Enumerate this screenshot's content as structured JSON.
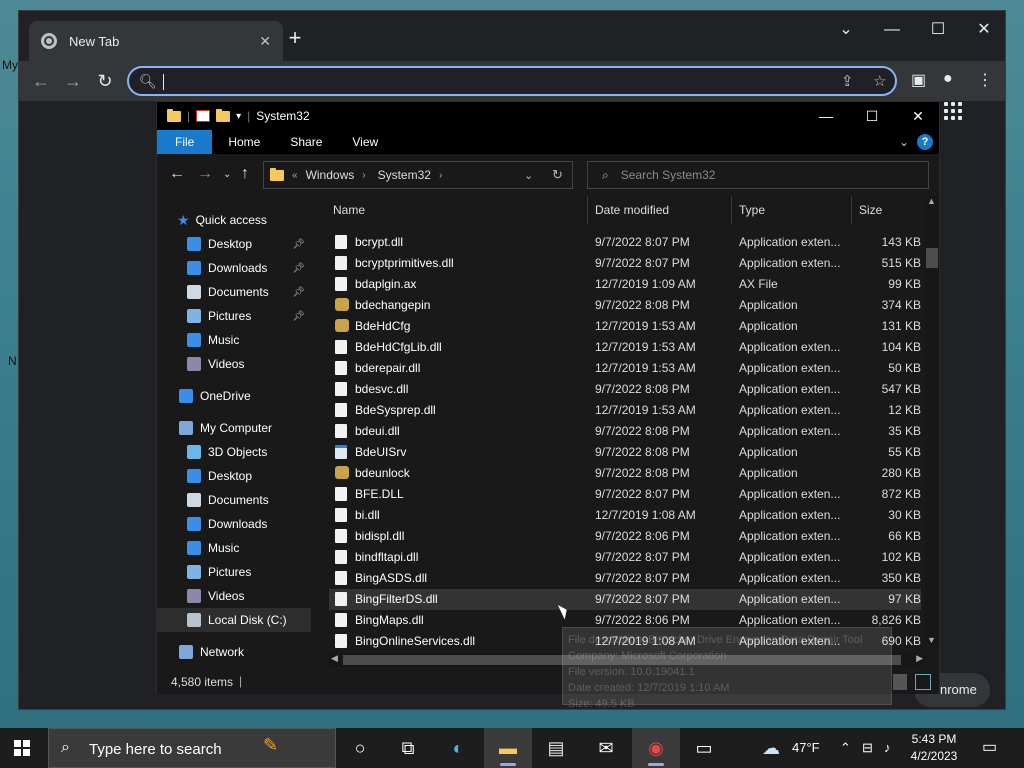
{
  "desktop": {
    "label_left_1": "My",
    "label_left_2": "N"
  },
  "chrome": {
    "tab_title": "New Tab",
    "new_tab_symbol": "+",
    "window_controls": {
      "dropdown": "⌄",
      "minimize": "—",
      "maximize": "☐",
      "close": "✕"
    },
    "omnibox_value": "",
    "bottom_button_label": "nrome"
  },
  "explorer": {
    "title": "System32",
    "ribbon_tabs": [
      "File",
      "Home",
      "Share",
      "View"
    ],
    "address": {
      "overflow": "«",
      "crumbs": [
        "Windows",
        "System32"
      ]
    },
    "search_placeholder": "Search System32",
    "nav": {
      "quick_access": "Quick access",
      "quick_items": [
        {
          "label": "Desktop",
          "icon": "desktop-icon",
          "pinned": true
        },
        {
          "label": "Downloads",
          "icon": "downloads-icon",
          "pinned": true
        },
        {
          "label": "Documents",
          "icon": "documents-icon",
          "pinned": true
        },
        {
          "label": "Pictures",
          "icon": "pictures-icon",
          "pinned": true
        },
        {
          "label": "Music",
          "icon": "music-icon",
          "pinned": false
        },
        {
          "label": "Videos",
          "icon": "videos-icon",
          "pinned": false
        }
      ],
      "onedrive": "OneDrive",
      "computer": "My Computer",
      "computer_items": [
        {
          "label": "3D Objects",
          "icon": "3d-objects-icon"
        },
        {
          "label": "Desktop",
          "icon": "desktop-icon"
        },
        {
          "label": "Documents",
          "icon": "documents-icon"
        },
        {
          "label": "Downloads",
          "icon": "downloads-icon"
        },
        {
          "label": "Music",
          "icon": "music-icon"
        },
        {
          "label": "Pictures",
          "icon": "pictures-icon"
        },
        {
          "label": "Videos",
          "icon": "videos-icon"
        },
        {
          "label": "Local Disk (C:)",
          "icon": "local-disk-icon"
        }
      ],
      "network": "Network"
    },
    "columns": {
      "name": "Name",
      "date": "Date modified",
      "type": "Type",
      "size": "Size"
    },
    "files": [
      {
        "name": "bcrypt.dll",
        "date": "9/7/2022 8:07 PM",
        "type": "Application exten...",
        "size": "143 KB",
        "kind": "dll"
      },
      {
        "name": "bcryptprimitives.dll",
        "date": "9/7/2022 8:07 PM",
        "type": "Application exten...",
        "size": "515 KB",
        "kind": "dll"
      },
      {
        "name": "bdaplgin.ax",
        "date": "12/7/2019 1:09 AM",
        "type": "AX File",
        "size": "99 KB",
        "kind": "dll"
      },
      {
        "name": "bdechangepin",
        "date": "9/7/2022 8:08 PM",
        "type": "Application",
        "size": "374 KB",
        "kind": "app"
      },
      {
        "name": "BdeHdCfg",
        "date": "12/7/2019 1:53 AM",
        "type": "Application",
        "size": "131 KB",
        "kind": "app"
      },
      {
        "name": "BdeHdCfgLib.dll",
        "date": "12/7/2019 1:53 AM",
        "type": "Application exten...",
        "size": "104 KB",
        "kind": "dll"
      },
      {
        "name": "bderepair.dll",
        "date": "12/7/2019 1:53 AM",
        "type": "Application exten...",
        "size": "50 KB",
        "kind": "dll"
      },
      {
        "name": "bdesvc.dll",
        "date": "9/7/2022 8:08 PM",
        "type": "Application exten...",
        "size": "547 KB",
        "kind": "dll"
      },
      {
        "name": "BdeSysprep.dll",
        "date": "12/7/2019 1:53 AM",
        "type": "Application exten...",
        "size": "12 KB",
        "kind": "dll"
      },
      {
        "name": "bdeui.dll",
        "date": "9/7/2022 8:08 PM",
        "type": "Application exten...",
        "size": "35 KB",
        "kind": "dll"
      },
      {
        "name": "BdeUISrv",
        "date": "9/7/2022 8:08 PM",
        "type": "Application",
        "size": "55 KB",
        "kind": "exe"
      },
      {
        "name": "bdeunlock",
        "date": "9/7/2022 8:08 PM",
        "type": "Application",
        "size": "280 KB",
        "kind": "app"
      },
      {
        "name": "BFE.DLL",
        "date": "9/7/2022 8:07 PM",
        "type": "Application exten...",
        "size": "872 KB",
        "kind": "dll"
      },
      {
        "name": "bi.dll",
        "date": "12/7/2019 1:08 AM",
        "type": "Application exten...",
        "size": "30 KB",
        "kind": "dll"
      },
      {
        "name": "bidispl.dll",
        "date": "9/7/2022 8:06 PM",
        "type": "Application exten...",
        "size": "66 KB",
        "kind": "dll"
      },
      {
        "name": "bindfltapi.dll",
        "date": "9/7/2022 8:07 PM",
        "type": "Application exten...",
        "size": "102 KB",
        "kind": "dll"
      },
      {
        "name": "BingASDS.dll",
        "date": "9/7/2022 8:07 PM",
        "type": "Application exten...",
        "size": "350 KB",
        "kind": "dll"
      },
      {
        "name": "BingFilterDS.dll",
        "date": "9/7/2022 8:07 PM",
        "type": "Application exten...",
        "size": "97 KB",
        "kind": "dll",
        "selected": true
      },
      {
        "name": "BingMaps.dll",
        "date": "9/7/2022 8:06 PM",
        "type": "Application exten...",
        "size": "8,826 KB",
        "kind": "dll"
      },
      {
        "name": "BingOnlineServices.dll",
        "date": "12/7/2019 1:08 AM",
        "type": "Application exten...",
        "size": "690 KB",
        "kind": "dll"
      }
    ],
    "status_items": "4,580 items",
    "tooltip_lines": [
      "File description: BitLocker Drive Encryption Data Repair Tool",
      "Company: Microsoft Corporation",
      "File version: 10.0.19041.1",
      "Date created: 12/7/2019 1:10 AM",
      "Size: 49.5 KB"
    ]
  },
  "taskbar": {
    "search_placeholder": "Type here to search",
    "weather": "47°F",
    "time": "5:43 PM",
    "date": "4/2/2023"
  },
  "colors": {
    "accent": "#1979ca",
    "chrome_focus": "#8ab4f8",
    "folder": "#f4c95d"
  }
}
